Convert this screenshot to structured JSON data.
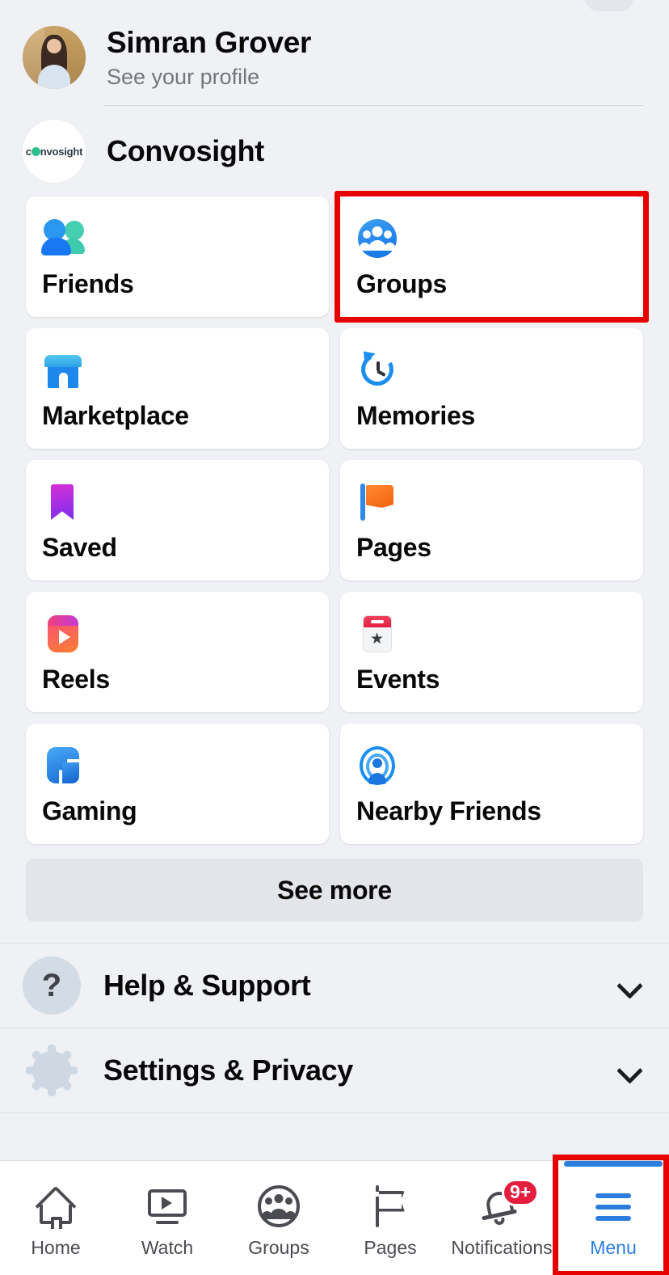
{
  "profile": {
    "name": "Simran Grover",
    "subtitle": "See your profile",
    "avatar_icon": "user-avatar-photo"
  },
  "page_account": {
    "name": "Convosight",
    "logo_text": "convosight",
    "logo_icon": "convosight-logo"
  },
  "shortcuts": [
    {
      "label": "Friends",
      "icon": "friends-icon",
      "highlighted": false
    },
    {
      "label": "Groups",
      "icon": "groups-icon",
      "highlighted": true
    },
    {
      "label": "Marketplace",
      "icon": "marketplace-icon",
      "highlighted": false
    },
    {
      "label": "Memories",
      "icon": "memories-icon",
      "highlighted": false
    },
    {
      "label": "Saved",
      "icon": "saved-bookmark-icon",
      "highlighted": false
    },
    {
      "label": "Pages",
      "icon": "pages-flag-icon",
      "highlighted": false
    },
    {
      "label": "Reels",
      "icon": "reels-icon",
      "highlighted": false
    },
    {
      "label": "Events",
      "icon": "events-calendar-icon",
      "highlighted": false
    },
    {
      "label": "Gaming",
      "icon": "gaming-icon",
      "highlighted": false
    },
    {
      "label": "Nearby Friends",
      "icon": "nearby-friends-icon",
      "highlighted": false
    }
  ],
  "see_more": {
    "label": "See more"
  },
  "expandable_rows": [
    {
      "label": "Help & Support",
      "icon": "question-mark-icon",
      "chevron": "chevron-down-icon"
    },
    {
      "label": "Settings & Privacy",
      "icon": "gear-icon",
      "chevron": "chevron-down-icon"
    }
  ],
  "bottom_nav": [
    {
      "label": "Home",
      "icon": "home-icon",
      "active": false,
      "badge": "",
      "highlighted": false
    },
    {
      "label": "Watch",
      "icon": "watch-icon",
      "active": false,
      "badge": "",
      "highlighted": false
    },
    {
      "label": "Groups",
      "icon": "groups-nav-icon",
      "active": false,
      "badge": "",
      "highlighted": false
    },
    {
      "label": "Pages",
      "icon": "pages-nav-icon",
      "active": false,
      "badge": "",
      "highlighted": false
    },
    {
      "label": "Notifications",
      "icon": "notifications-icon",
      "active": false,
      "badge": "9+",
      "highlighted": false
    },
    {
      "label": "Menu",
      "icon": "hamburger-menu-icon",
      "active": true,
      "badge": "",
      "highlighted": true
    }
  ],
  "colors": {
    "background": "#eff1f5",
    "card": "#ffffff",
    "accent_blue": "#1877f2",
    "active_blue": "#2b7de0",
    "badge_red": "#e41e3f",
    "annotation_red": "#e60000",
    "see_more_bg": "#e3e5ea",
    "text_primary": "#080809",
    "text_secondary": "#73767c"
  }
}
